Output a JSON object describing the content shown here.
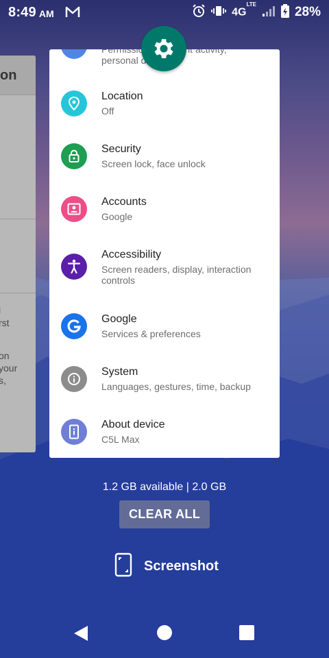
{
  "status_bar": {
    "time": "8:49",
    "ampm": "AM",
    "network": "4G",
    "network_sup": "LTE",
    "battery": "28%"
  },
  "bg_card": {
    "header": "on",
    "fragments": [
      "l",
      "rst",
      "on",
      "your",
      "s,"
    ]
  },
  "settings": {
    "partial_line1": "Permissions, account activity,",
    "partial_line2": "personal data",
    "items": [
      {
        "title": "Location",
        "subtitle": "Off",
        "icon": "location-pin-icon",
        "color": "#26c6da"
      },
      {
        "title": "Security",
        "subtitle": "Screen lock, face unlock",
        "icon": "lock-icon",
        "color": "#1e9e52"
      },
      {
        "title": "Accounts",
        "subtitle": "Google",
        "icon": "account-icon",
        "color": "#ec4f86"
      },
      {
        "title": "Accessibility",
        "subtitle": "Screen readers, display, interaction controls",
        "icon": "accessibility-icon",
        "color": "#5a1ea8"
      },
      {
        "title": "Google",
        "subtitle": "Services & preferences",
        "icon": "google-g-icon",
        "color": "#1a73e8"
      },
      {
        "title": "System",
        "subtitle": "Languages, gestures, time, backup",
        "icon": "info-icon",
        "color": "#8c8c8c"
      },
      {
        "title": "About device",
        "subtitle": "C5L Max",
        "icon": "phone-icon",
        "color": "#6f7fd6"
      }
    ]
  },
  "memory": "1.2 GB available | 2.0 GB",
  "clear_all": "CLEAR ALL",
  "screenshot_label": "Screenshot",
  "colors": {
    "settings_accent": "#00796b"
  }
}
